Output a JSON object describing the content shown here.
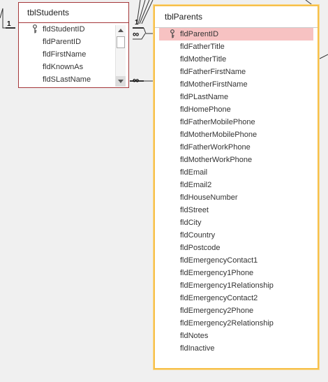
{
  "tables": {
    "students": {
      "title": "tblStudents",
      "fields": [
        {
          "name": "fldStudentID",
          "key": true
        },
        {
          "name": "fldParentID",
          "key": false
        },
        {
          "name": "fldFirstName",
          "key": false
        },
        {
          "name": "fldKnownAs",
          "key": false
        },
        {
          "name": "fldSLastName",
          "key": false
        }
      ]
    },
    "parents": {
      "title": "tblParents",
      "fields": [
        {
          "name": "fldParentID",
          "key": true,
          "selected": true
        },
        {
          "name": "fldFatherTitle"
        },
        {
          "name": "fldMotherTitle"
        },
        {
          "name": "fldFatherFirstName"
        },
        {
          "name": "fldMotherFirstName"
        },
        {
          "name": "fldPLastName"
        },
        {
          "name": "fldHomePhone"
        },
        {
          "name": "fldFatherMobilePhone"
        },
        {
          "name": "fldMotherMobilePhone"
        },
        {
          "name": "fldFatherWorkPhone"
        },
        {
          "name": "fldMotherWorkPhone"
        },
        {
          "name": "fldEmail"
        },
        {
          "name": "fldEmail2"
        },
        {
          "name": "fldHouseNumber"
        },
        {
          "name": "fldStreet"
        },
        {
          "name": "fldCity"
        },
        {
          "name": "fldCountry"
        },
        {
          "name": "fldPostcode"
        },
        {
          "name": "fldEmergencyContact1"
        },
        {
          "name": "fldEmergency1Phone"
        },
        {
          "name": "fldEmergency1Relationship"
        },
        {
          "name": "fldEmergencyContact2"
        },
        {
          "name": "fldEmergency2Phone"
        },
        {
          "name": "fldEmergency2Relationship"
        },
        {
          "name": "fldNotes"
        },
        {
          "name": "fldInactive"
        }
      ]
    }
  },
  "cardinality": {
    "left_one": "1",
    "parents_one": "1",
    "many_top": "∞",
    "many_bottom": "∞"
  },
  "colors": {
    "students_border": "#a4373a",
    "parents_border": "#f7c04a",
    "selected_row": "#f7c2c2",
    "canvas_bg": "#f0f0f0"
  },
  "icons": {
    "primary_key": "key-icon",
    "scroll_up": "scroll-up-arrow-icon",
    "scroll_down": "scroll-down-arrow-icon"
  }
}
